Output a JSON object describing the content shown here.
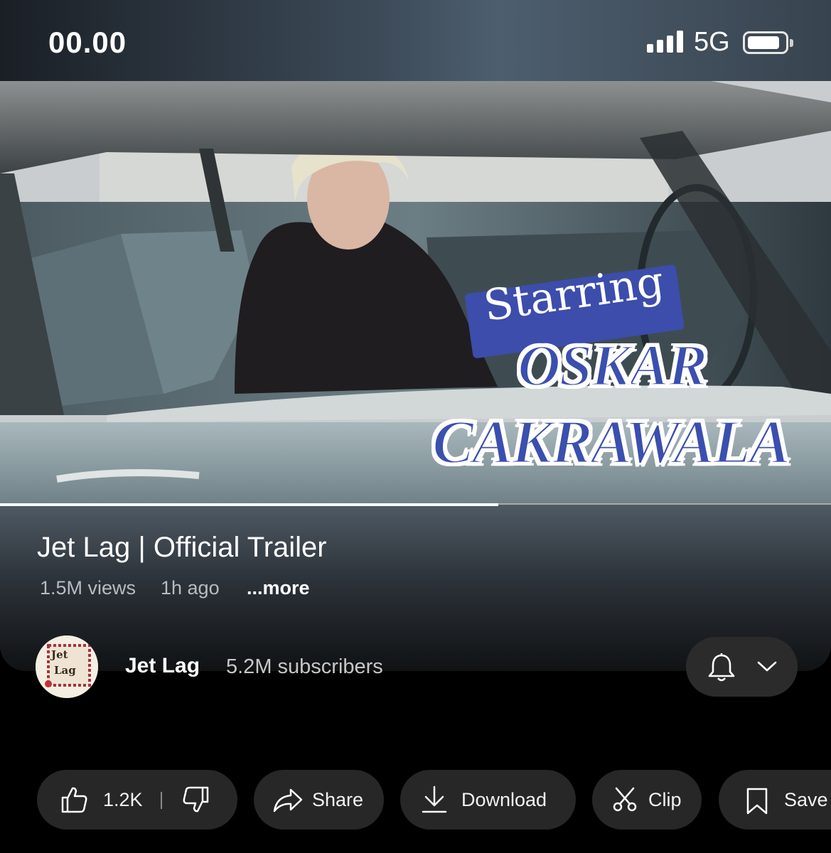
{
  "status_bar": {
    "time": "00.00",
    "network": "5G",
    "signal_icon": "cellular-signal-icon",
    "battery_icon": "battery-icon"
  },
  "video": {
    "overlay_starring": "Starring",
    "overlay_name_line1": "OSKAR",
    "overlay_name_line2": "CAKRAWALA",
    "progress_fraction": 0.6
  },
  "details": {
    "title": "Jet Lag | Official Trailer",
    "views": "1.5M views",
    "posted": "1h ago",
    "more": "...more"
  },
  "channel": {
    "name": "Jet Lag",
    "subscribers": "5.2M subscribers",
    "avatar_text_1": "Jet",
    "avatar_text_2": "Lag"
  },
  "actions": {
    "like_count": "1.2K",
    "share": "Share",
    "download": "Download",
    "clip": "Clip",
    "save": "Save"
  }
}
